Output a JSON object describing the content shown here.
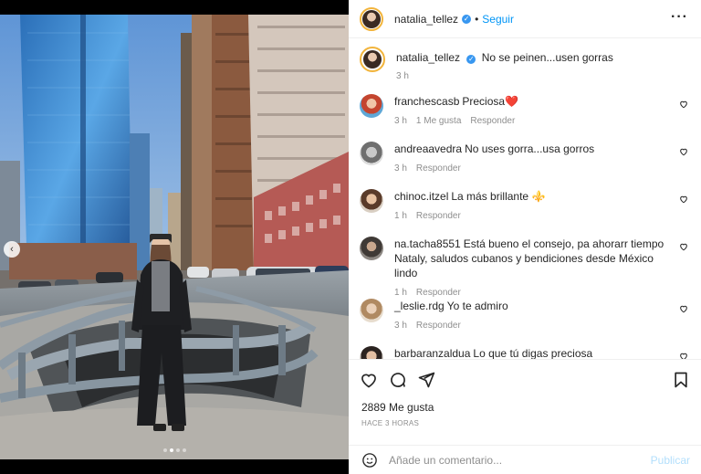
{
  "post": {
    "username": "natalia_tellez",
    "verified": true,
    "follow_label": "Seguir",
    "separator": "•",
    "more_icon": "more-horizontal-icon",
    "caption": "No se peinen...usen gorras",
    "caption_time": "3 h"
  },
  "comments": [
    {
      "user": "franchescasb",
      "text": "Preciosa",
      "emoji": "❤️",
      "time": "3 h",
      "likes": "1 Me gusta",
      "reply": "Responder"
    },
    {
      "user": "andreaavedra",
      "text": "No uses gorra...usa gorros",
      "time": "3 h",
      "likes": "",
      "reply": "Responder"
    },
    {
      "user": "chinoc.itzel",
      "text": "La más brillante",
      "emoji": "⚜️",
      "time": "1 h",
      "likes": "",
      "reply": "Responder"
    },
    {
      "user": "na.tacha8551",
      "text": "Está bueno el consejo, pa ahorarr tiempo Nataly, saludos cubanos y bendiciones desde México lindo",
      "time": "1 h",
      "likes": "",
      "reply": "Responder"
    },
    {
      "user": "_leslie.rdg",
      "text": "Yo te admiro",
      "time": "3 h",
      "likes": "",
      "reply": "Responder"
    },
    {
      "user": "barbaranzaldua",
      "text": "Lo que tú digas preciosa",
      "time": "",
      "likes": "",
      "reply": ""
    }
  ],
  "stats": {
    "likes": "2889 Me gusta",
    "ago": "HACE 3 HORAS"
  },
  "add_comment": {
    "placeholder": "Añade un comentario...",
    "post_label": "Publicar"
  },
  "carousel": {
    "prev_icon": "chevron-left-icon",
    "dot_count": 4,
    "active_dot": 1
  },
  "colors": {
    "accent": "#0095f6",
    "verified": "#3897f0",
    "muted": "#8e8e8e",
    "heart": "#ed4956",
    "post_disabled": "#b2dffc"
  }
}
